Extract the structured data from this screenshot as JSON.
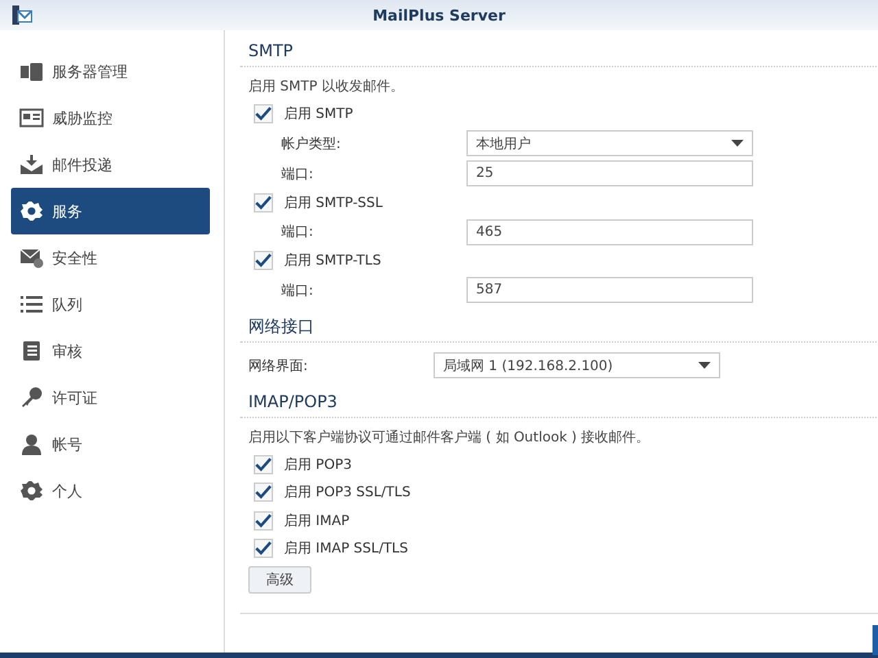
{
  "window": {
    "title": "MailPlus Server"
  },
  "sidebar": {
    "items": [
      {
        "label": "服务器管理",
        "selected": false
      },
      {
        "label": "威胁监控",
        "selected": false
      },
      {
        "label": "邮件投递",
        "selected": false
      },
      {
        "label": "服务",
        "selected": true
      },
      {
        "label": "安全性",
        "selected": false
      },
      {
        "label": "队列",
        "selected": false
      },
      {
        "label": "审核",
        "selected": false
      },
      {
        "label": "许可证",
        "selected": false
      },
      {
        "label": "帐号",
        "selected": false
      },
      {
        "label": "个人",
        "selected": false
      }
    ]
  },
  "sections": [
    {
      "title": "SMTP",
      "description": "启用 SMTP 以收发邮件。",
      "rows": [
        {
          "kind": "checkbox",
          "label": "启用 SMTP",
          "checked": true
        },
        {
          "kind": "select",
          "label": "帐户类型:",
          "value": "本地用户"
        },
        {
          "kind": "input",
          "label": "端口:",
          "value": "25"
        },
        {
          "kind": "checkbox",
          "label": "启用 SMTP-SSL",
          "checked": true
        },
        {
          "kind": "input",
          "label": "端口:",
          "value": "465"
        },
        {
          "kind": "checkbox",
          "label": "启用 SMTP-TLS",
          "checked": true
        },
        {
          "kind": "input",
          "label": "端口:",
          "value": "587"
        }
      ]
    },
    {
      "title": "网络接口",
      "rows": [
        {
          "kind": "select",
          "label": "网络界面:",
          "value": "局域网 1 (192.168.2.100)"
        }
      ]
    },
    {
      "title": "IMAP/POP3",
      "description": "启用以下客户端协议可通过邮件客户端 ( 如 Outlook ) 接收邮件。",
      "rows": [
        {
          "kind": "checkbox",
          "label": "启用 POP3",
          "checked": true
        },
        {
          "kind": "checkbox",
          "label": "启用 POP3 SSL/TLS",
          "checked": true
        },
        {
          "kind": "checkbox",
          "label": "启用 IMAP",
          "checked": true
        },
        {
          "kind": "checkbox",
          "label": "启用 IMAP SSL/TLS",
          "checked": true
        },
        {
          "kind": "button",
          "label": "高级"
        }
      ]
    }
  ]
}
